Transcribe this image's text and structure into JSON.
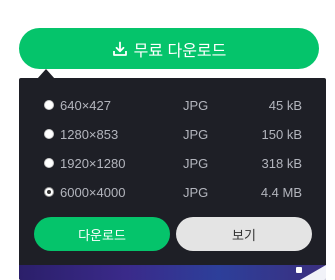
{
  "download_button": {
    "label": "무료 다운로드",
    "icon": "download-icon",
    "color": "#05c46b"
  },
  "options": [
    {
      "resolution": "640×427",
      "format": "JPG",
      "size": "45 kB",
      "selected": false
    },
    {
      "resolution": "1280×853",
      "format": "JPG",
      "size": "150 kB",
      "selected": false
    },
    {
      "resolution": "1920×1280",
      "format": "JPG",
      "size": "318 kB",
      "selected": false
    },
    {
      "resolution": "6000×4000",
      "format": "JPG",
      "size": "4.4 MB",
      "selected": true
    }
  ],
  "actions": {
    "download_label": "다운로드",
    "view_label": "보기"
  },
  "colors": {
    "accent": "#05c46b",
    "panel_bg": "#1e1f26",
    "secondary_btn": "#e4e4e4"
  }
}
